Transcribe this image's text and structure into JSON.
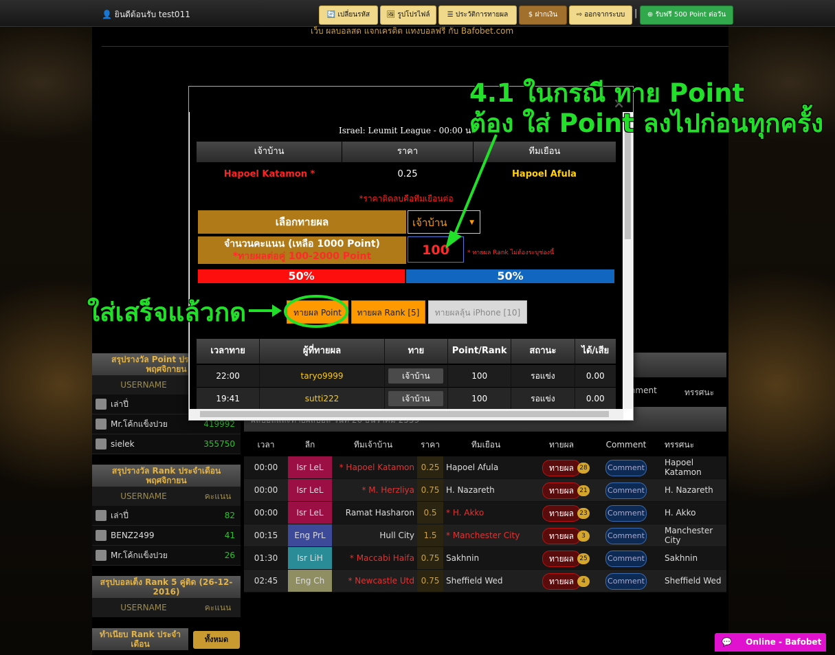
{
  "topbar": {
    "welcome": "ยินดีต้อนรับ test011",
    "buttons": [
      "เปลี่ยนรหัส",
      "รูปโปรไฟล์",
      "ประวัติการทายผล",
      "ฝากเงิน",
      "ออกจากระบบ"
    ],
    "bonus": "รับฟรี 500 Point ต่อวัน",
    "separator": "|"
  },
  "marquee": "เว็บ ผลบอลสด แจกเครดิต แทงบอลฟรี กับ Bafobet.com",
  "sidebar": {
    "point_box": {
      "title": "สรุปรางวัล Point ประจำเดือน พฤศจิกายน",
      "col_user": "USERNAME",
      "rows": [
        {
          "user": "เล่าปี่",
          "score": ""
        },
        {
          "user": "Mr.โค้กแข็งปวย",
          "score": "419992"
        },
        {
          "user": "sielek",
          "score": "355750"
        }
      ]
    },
    "rank_box": {
      "title": "สรุปรางวัล Rank ประจำเดือน พฤศจิกายน",
      "col_user": "USERNAME",
      "col_score": "คะแนน",
      "rows": [
        {
          "user": "เล่าปี่",
          "score": "82"
        },
        {
          "user": "BENZ2499",
          "score": "41"
        },
        {
          "user": "Mr.โค้กแข็งปวย",
          "score": "26"
        }
      ]
    },
    "rank5_box": {
      "title": "สรุปบอลเต็ง Rank 5 คู่ติด (26-12-2016)",
      "col_user": "USERNAME",
      "col_score": "คะแนน"
    },
    "monthly": {
      "title": "ทำเนียบ Rank ประจำเดือน",
      "all": "ทั้งหมด"
    }
  },
  "main": {
    "behind_header": {
      "comment": "Comment",
      "view": "ทรรศนะ"
    },
    "strip_text": "ผลบอลและทายผลบอล วันที่ 26 ธันวาคม 2559",
    "headers": [
      "เวลา",
      "ลีก",
      "ทีมเจ้าบ้าน",
      "ราคา",
      "ทีมเยือน",
      "ทายผล",
      "Comment",
      "ทรรศนะ"
    ],
    "rows": [
      {
        "time": "00:00",
        "league": "Isr LeL",
        "lcolor": "#9b0f45",
        "home": "* Hapoel Katamon",
        "home_fav": true,
        "price": "0.25",
        "away": "Hapoel Afula",
        "away_fav": false,
        "guess": "ทายผล",
        "count": "28",
        "comment": "Comment",
        "view": "Hapoel Katamon"
      },
      {
        "time": "00:00",
        "league": "Isr LeL",
        "lcolor": "#9b0f45",
        "home": "* M. Herzliya",
        "home_fav": true,
        "price": "0.75",
        "away": "H. Nazareth",
        "away_fav": false,
        "guess": "ทายผล",
        "count": "21",
        "comment": "Comment",
        "view": "H. Nazareth"
      },
      {
        "time": "00:00",
        "league": "Isr LeL",
        "lcolor": "#9b0f45",
        "home": "Ramat Hasharon",
        "home_fav": false,
        "price": "0.5",
        "away": "* H. Akko",
        "away_fav": true,
        "guess": "ทายผล",
        "count": "23",
        "comment": "Comment",
        "view": "H. Akko"
      },
      {
        "time": "00:15",
        "league": "Eng PrL",
        "lcolor": "#3d4a9a",
        "home": "Hull City",
        "home_fav": false,
        "price": "1.5",
        "away": "* Manchester City",
        "away_fav": true,
        "guess": "ทายผล",
        "count": "3",
        "comment": "Comment",
        "view": "Manchester City"
      },
      {
        "time": "01:30",
        "league": "Isr LiH",
        "lcolor": "#2a8c96",
        "home": "* Maccabi Haifa",
        "home_fav": true,
        "price": "0.75",
        "away": "Sakhnin",
        "away_fav": false,
        "guess": "ทายผล",
        "count": "25",
        "comment": "Comment",
        "view": "Sakhnin"
      },
      {
        "time": "02:45",
        "league": "Eng Ch",
        "lcolor": "#8e8e62",
        "home": "* Newcastle Utd",
        "home_fav": true,
        "price": "0.75",
        "away": "Sheffield Wed",
        "away_fav": false,
        "guess": "ทายผล",
        "count": "4",
        "comment": "Comment",
        "view": "Sheffield Wed"
      }
    ]
  },
  "modal": {
    "close": "×",
    "league": "Israel: Leumit League  - 00:00 น.",
    "col_home": "เจ้าบ้าน",
    "col_price": "ราคา",
    "col_away": "ทีมเยือน",
    "home_team": "Hapoel Katamon *",
    "price": "0.25",
    "away_team": "Hapoel Afula",
    "note": "*ราคาติดลบคือทีมเยือนต่อ",
    "choose_label": "เลือกทายผล",
    "choose_value": "เจ้าบ้าน",
    "amount_label": "จำนวนคะแนน (เหลือ 1000 Point)",
    "amount_sub": "*ทายผลต่อคู่ 100-2000 Point",
    "amount_value": "100",
    "amount_note": "* ทายผล Rank ไม่ต้องระบุช่องนี้",
    "pct_home": "50%",
    "pct_away": "50%",
    "pct_home_value": 0.5,
    "btn_point": "ทายผล Point",
    "btn_rank": "ทายผล Rank [5]",
    "btn_iphone": "ทายผลลุ้น iPhone [10]",
    "result_headers": [
      "เวลาทาย",
      "ผู้ที่ทายผล",
      "ทาย",
      "Point/Rank",
      "สถานะ",
      "ได้/เสีย"
    ],
    "results": [
      {
        "time": "22:00",
        "user": "taryo9999",
        "pick": "เจ้าบ้าน",
        "pts": "100",
        "status": "รอแข่ง",
        "gain": "0.00"
      },
      {
        "time": "19:41",
        "user": "sutti222",
        "pick": "เจ้าบ้าน",
        "pts": "100",
        "status": "รอแข่ง",
        "gain": "0.00"
      }
    ]
  },
  "annotations": {
    "top_line1": "4.1 ในกรณี ทาย Point",
    "top_line2": "ต้อง ใส่ Point ลงไปก่อนทุกครั้ง",
    "left": "ใส่เสร็จแล้วกด",
    "color": "#22e02a"
  },
  "chat": {
    "label": "Online - Bafobet"
  }
}
